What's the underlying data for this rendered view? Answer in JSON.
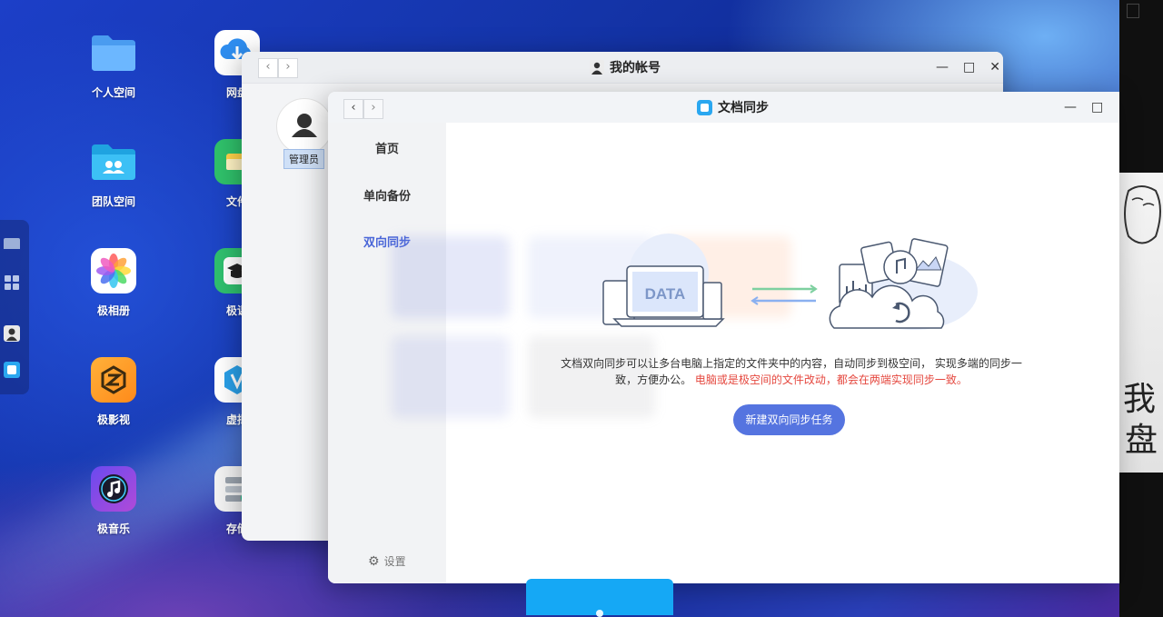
{
  "desktop": {
    "icons": [
      {
        "label": "个人空间",
        "icon": "folder-icon"
      },
      {
        "label": "网盘",
        "icon": "cloud-download-icon"
      },
      {
        "label": "团队空间",
        "icon": "team-folder-icon"
      },
      {
        "label": "文件",
        "icon": "file-manager-icon"
      },
      {
        "label": "极相册",
        "icon": "photos-icon"
      },
      {
        "label": "极课",
        "icon": "course-icon"
      },
      {
        "label": "极影视",
        "icon": "video-icon"
      },
      {
        "label": "虚拟",
        "icon": "virtual-machine-icon"
      },
      {
        "label": "极音乐",
        "icon": "music-icon"
      },
      {
        "label": "存储",
        "icon": "storage-icon"
      }
    ]
  },
  "account_window": {
    "title": "我的帐号",
    "admin_label": "管理员"
  },
  "sync_window": {
    "title": "文档同步",
    "sidebar": {
      "items": [
        {
          "label": "首页",
          "active": false
        },
        {
          "label": "单向备份",
          "active": false
        },
        {
          "label": "双向同步",
          "active": true
        }
      ],
      "settings_label": "设置"
    },
    "main": {
      "illustration_text": "DATA",
      "description": "文档双向同步可以让多台电脑上指定的文件夹中的内容，自动同步到极空间， 实现多端的同步一致，方便办公。",
      "warning": "电脑或是极空间的文件改动，都会在两端实现同步一致。",
      "button_label": "新建双向同步任务"
    }
  },
  "colors": {
    "accent": "#4a66d8",
    "button": "#5574e0",
    "warning": "#e5483f",
    "taskbar": "#15a8f5"
  }
}
